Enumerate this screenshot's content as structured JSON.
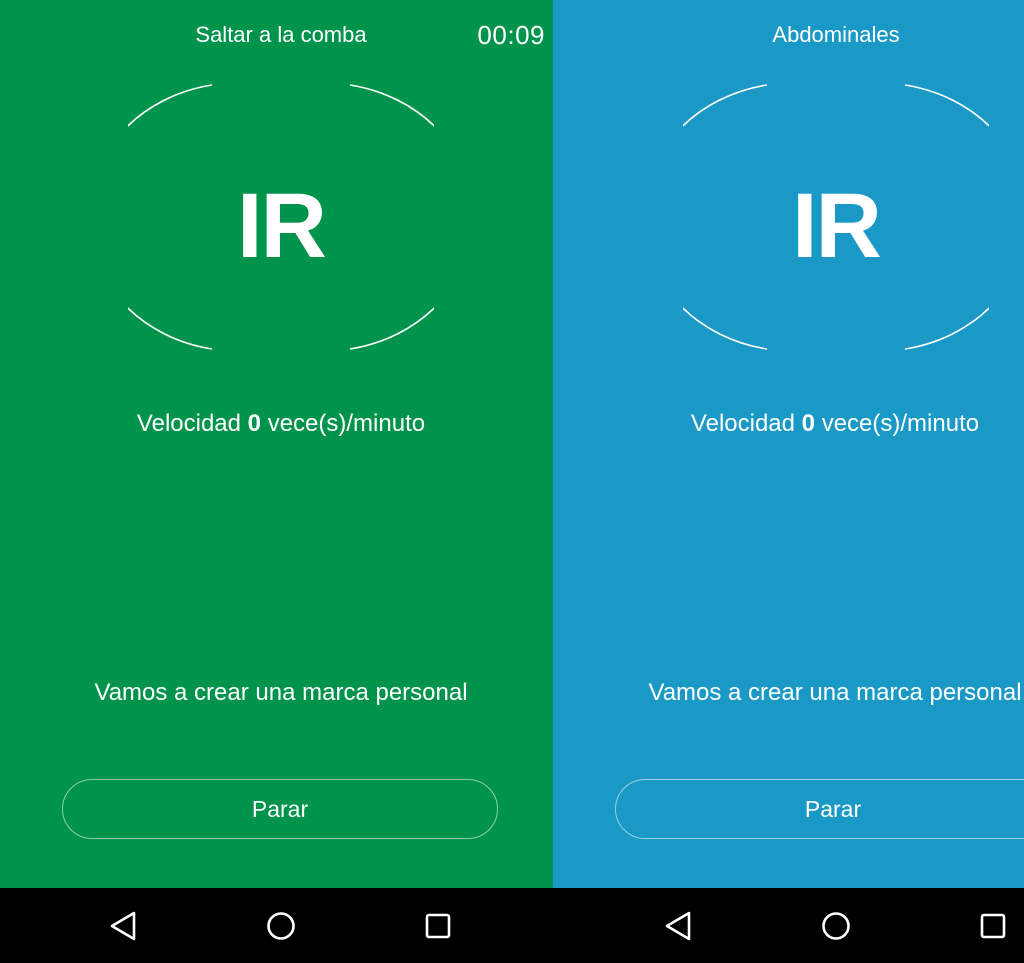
{
  "colors": {
    "left_background": "#00934b",
    "right_background": "#1a99c7",
    "navbar_background": "#000000",
    "text": "#ffffff"
  },
  "left_screen": {
    "title": "Saltar a la comba",
    "timer": "00:09",
    "go_label": "IR",
    "speed": {
      "prefix": "Velocidad",
      "value": "0",
      "unit": "vece(s)/minuto"
    },
    "motivation": "Vamos a crear una marca personal",
    "stop_label": "Parar"
  },
  "right_screen": {
    "title": "Abdominales",
    "go_label": "IR",
    "speed": {
      "prefix": "Velocidad",
      "value": "0",
      "unit": "vece(s)/minuto"
    },
    "motivation": "Vamos a crear una marca personal",
    "stop_label": "Parar"
  },
  "navbar": {
    "icons": [
      "back-triangle-icon",
      "home-circle-icon",
      "recents-square-icon"
    ]
  }
}
